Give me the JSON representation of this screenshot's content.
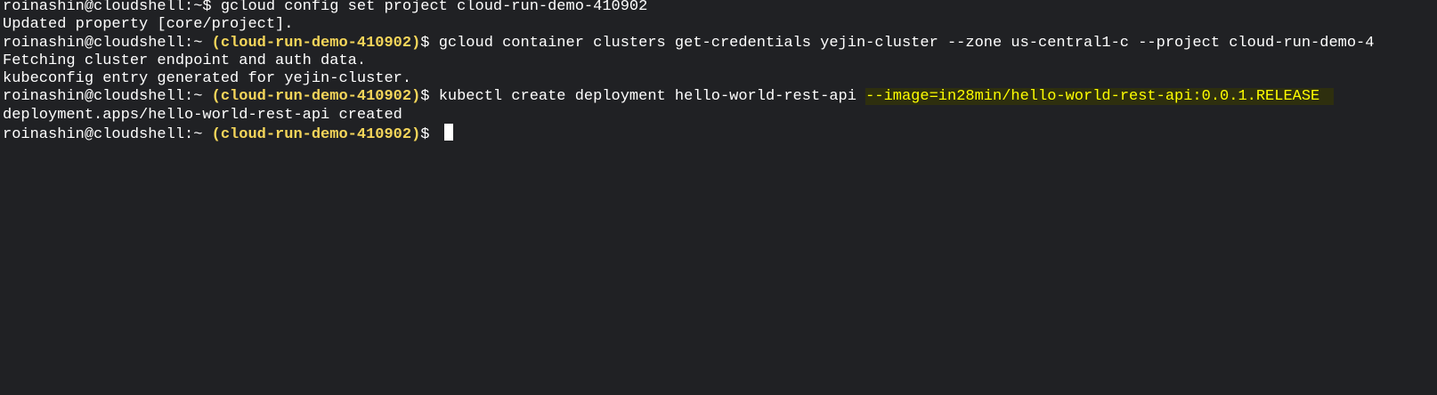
{
  "terminal": {
    "lines": [
      {
        "prompt": "roinashin@cloudshell:~$ ",
        "project": "",
        "command": "gcloud config set project cloud-run-demo-410902"
      },
      {
        "output": "Updated property [core/project]."
      },
      {
        "prompt": "roinashin@cloudshell:~ ",
        "project": "(cloud-run-demo-410902)",
        "suffix": "$ ",
        "command": "gcloud container clusters get-credentials yejin-cluster --zone us-central1-c --project cloud-run-demo-4"
      },
      {
        "output": "Fetching cluster endpoint and auth data."
      },
      {
        "output": "kubeconfig entry generated for yejin-cluster."
      },
      {
        "prompt": "roinashin@cloudshell:~ ",
        "project": "(cloud-run-demo-410902)",
        "suffix": "$ ",
        "command": "kubectl create deployment hello-world-rest-api ",
        "selected": "--image=in28min/hello-world-rest-api:0.0.1.RELEASE"
      },
      {
        "output": "deployment.apps/hello-world-rest-api created"
      },
      {
        "prompt": "roinashin@cloudshell:~ ",
        "project": "(cloud-run-demo-410902)",
        "suffix": "$ ",
        "command": ""
      }
    ]
  },
  "colors": {
    "background": "#202124",
    "text": "#ffffff",
    "project": "#f5d65a",
    "selection_text": "#ffff00",
    "selection_bg": "#2e2f0e"
  }
}
